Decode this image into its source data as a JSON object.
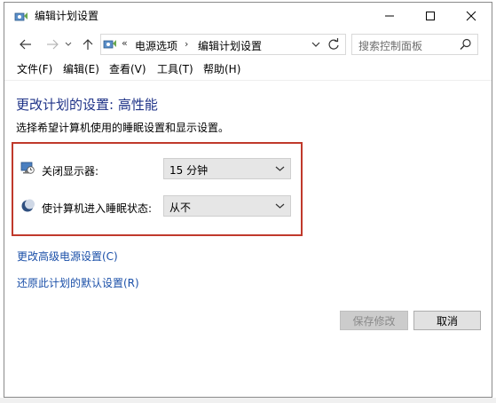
{
  "window": {
    "title": "编辑计划设置"
  },
  "address": {
    "breadcrumb": [
      "电源选项",
      "编辑计划设置"
    ],
    "search_placeholder": "搜索控制面板"
  },
  "menu": [
    "文件(F)",
    "编辑(E)",
    "查看(V)",
    "工具(T)",
    "帮助(H)"
  ],
  "main": {
    "heading": "更改计划的设置: 高性能",
    "subtext": "选择希望计算机使用的睡眠设置和显示设置。",
    "settings": [
      {
        "label": "关闭显示器:",
        "value": "15 分钟",
        "icon": "monitor-clock-icon"
      },
      {
        "label": "使计算机进入睡眠状态:",
        "value": "从不",
        "icon": "sleep-moon-icon"
      }
    ],
    "links": [
      "更改高级电源设置(C)",
      "还原此计划的默认设置(R)"
    ],
    "buttons": {
      "save": "保存修改",
      "cancel": "取消"
    }
  },
  "colors": {
    "heading": "#1e3287",
    "link": "#1a4fa8",
    "highlight_box": "#c0392b"
  }
}
